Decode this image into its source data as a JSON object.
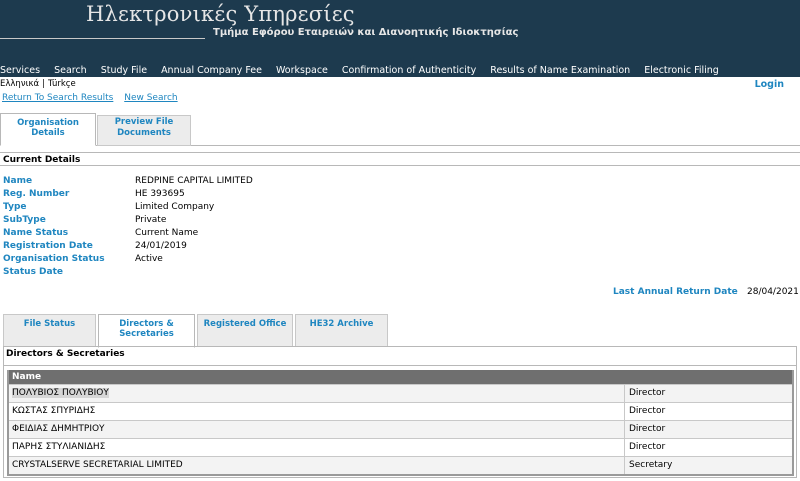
{
  "header": {
    "title": "Ηλεκτρονικές Υπηρεσίες",
    "subtitle": "Τμήμα Εφόρου Εταιρειών και Διανοητικής Ιδιοκτησίας"
  },
  "nav": {
    "items": [
      "Services",
      "Search",
      "Study File",
      "Annual Company Fee",
      "Workspace",
      "Confirmation of Authenticity",
      "Results of Name Examination",
      "Electronic Filing"
    ]
  },
  "language": {
    "greek": "Ελληνικά",
    "separator": "|",
    "turkish": "Türkçe"
  },
  "login_label": "Login",
  "links": {
    "return": "Return To Search Results",
    "new_search": "New Search"
  },
  "top_tabs": {
    "active": "Organisation Details",
    "inactive_line1": "Preview File",
    "inactive_line2": "Documents"
  },
  "current_details": {
    "heading": "Current Details",
    "fields": [
      {
        "label": "Name",
        "value": "REDPINE CAPITAL LIMITED"
      },
      {
        "label": "Reg. Number",
        "value": "HE 393695"
      },
      {
        "label": "Type",
        "value": "Limited Company"
      },
      {
        "label": "SubType",
        "value": "Private"
      },
      {
        "label": "Name Status",
        "value": "Current Name"
      },
      {
        "label": "Registration Date",
        "value": "24/01/2019"
      },
      {
        "label": "Organisation Status",
        "value": "Active"
      },
      {
        "label": "Status Date",
        "value": ""
      }
    ],
    "last_annual_return_label": "Last Annual Return Date",
    "last_annual_return_value": "28/04/2021"
  },
  "bottom_tabs": [
    "File Status",
    "Directors & Secretaries",
    "Registered Office",
    "HE32 Archive"
  ],
  "directors": {
    "heading": "Directors & Secretaries",
    "column_name": "Name",
    "rows": [
      {
        "name": "ΠΟΛΥΒΙΟΣ ΠΟΛΥΒΙΟΥ",
        "role": "Director"
      },
      {
        "name": "ΚΩΣΤΑΣ ΣΠΥΡΙΔΗΣ",
        "role": "Director"
      },
      {
        "name": "ΦΕΙΔΙΑΣ ΔΗΜΗΤΡΙΟΥ",
        "role": "Director"
      },
      {
        "name": "ΠΑΡΗΣ ΣΤΥΛΙΑΝΙΔΗΣ",
        "role": "Director"
      },
      {
        "name": "CRYSTALSERVE SECRETARIAL LIMITED",
        "role": "Secretary"
      }
    ]
  },
  "colors": {
    "header_bg": "#1d3a4e",
    "link_blue": "#1f86c0",
    "grid_header": "#6f6f6f"
  }
}
